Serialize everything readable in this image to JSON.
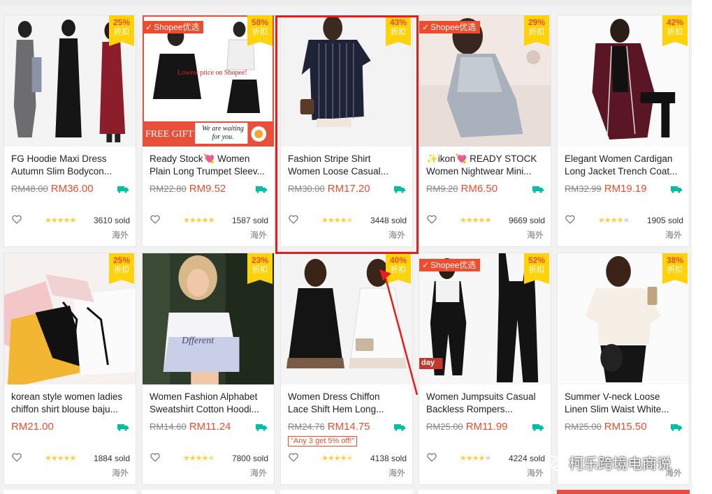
{
  "watermark": {
    "text": "柯乐跨境电商说",
    "icon": "wechat-icon"
  },
  "labels": {
    "mall": "Shopee优选",
    "discount_suffix": "折扣",
    "tick": "✓"
  },
  "colors": {
    "accent": "#ee4d2d",
    "discount_bg": "#ffd30c",
    "star": "#ffce3d",
    "highlight": "#e61d1d"
  },
  "products": [
    {
      "title1": "FG Hoodie Maxi Dress",
      "title2": "Autumn Slim Bodycon...",
      "old_price": "RM48.00",
      "price": "RM36.00",
      "discount": "25%",
      "sold": "3610 sold",
      "origin": "海外",
      "rating": 5,
      "mall": false,
      "promo": ""
    },
    {
      "title1": "Ready Stock💘 Women",
      "title2": "Plain Long Trumpet Sleev...",
      "old_price": "RM22.80",
      "price": "RM9.52",
      "discount": "58%",
      "sold": "1587 sold",
      "origin": "海外",
      "rating": 5,
      "mall": true,
      "promo": "",
      "img_text1": "Lowest price on Shopee!",
      "img_text2": "FREE GIFT",
      "img_text3": "We are waiting",
      "img_text4": "for you."
    },
    {
      "title1": "Fashion Stripe Shirt",
      "title2": "Women Loose Casual...",
      "old_price": "RM30.00",
      "price": "RM17.20",
      "discount": "43%",
      "sold": "3448 sold",
      "origin": "海外",
      "rating": 4.5,
      "mall": false,
      "promo": ""
    },
    {
      "title1": "✨ikon💘 READY STOCK",
      "title2": "Women Nightwear Mini...",
      "old_price": "RM9.20",
      "price": "RM6.50",
      "discount": "29%",
      "sold": "9669 sold",
      "origin": "海外",
      "rating": 5,
      "mall": true,
      "promo": ""
    },
    {
      "title1": "Elegant Women Cardigan",
      "title2": "Long Jacket Trench Coat...",
      "old_price": "RM32.99",
      "price": "RM19.19",
      "discount": "42%",
      "sold": "1905 sold",
      "origin": "海外",
      "rating": 4,
      "mall": false,
      "promo": ""
    },
    {
      "title1": "korean style women ladies",
      "title2": "chiffon shirt blouse baju...",
      "old_price": "",
      "price": "RM21.00",
      "discount": "25%",
      "sold": "1884 sold",
      "origin": "海外",
      "rating": 5,
      "mall": false,
      "promo": ""
    },
    {
      "title1": "Women Fashion Alphabet",
      "title2": "Sweatshirt Cotton Hoodi...",
      "old_price": "RM14.60",
      "price": "RM11.24",
      "discount": "23%",
      "sold": "7800 sold",
      "origin": "海外",
      "rating": 4.5,
      "mall": false,
      "promo": "",
      "img_text1": "Dfferent"
    },
    {
      "title1": "Women Dress Chiffon",
      "title2": "Lace Shift Hem Long...",
      "old_price": "RM24.76",
      "price": "RM14.75",
      "discount": "40%",
      "sold": "4138 sold",
      "origin": "海外",
      "rating": 4.5,
      "mall": false,
      "promo": "\"Any 3 get 5% off!\""
    },
    {
      "title1": "Women Jumpsuits Casual",
      "title2": "Backless Rompers...",
      "old_price": "RM25.00",
      "price": "RM11.99",
      "discount": "52%",
      "sold": "4224 sold",
      "origin": "海外",
      "rating": 4,
      "mall": true,
      "promo": "",
      "img_text1": "day"
    },
    {
      "title1": "Summer V-neck Loose",
      "title2": "Linen Slim Waist White...",
      "old_price": "RM25.00",
      "price": "RM15.50",
      "discount": "38%",
      "sold": "",
      "origin": "海外",
      "rating": 4.5,
      "mall": false,
      "promo": ""
    }
  ]
}
